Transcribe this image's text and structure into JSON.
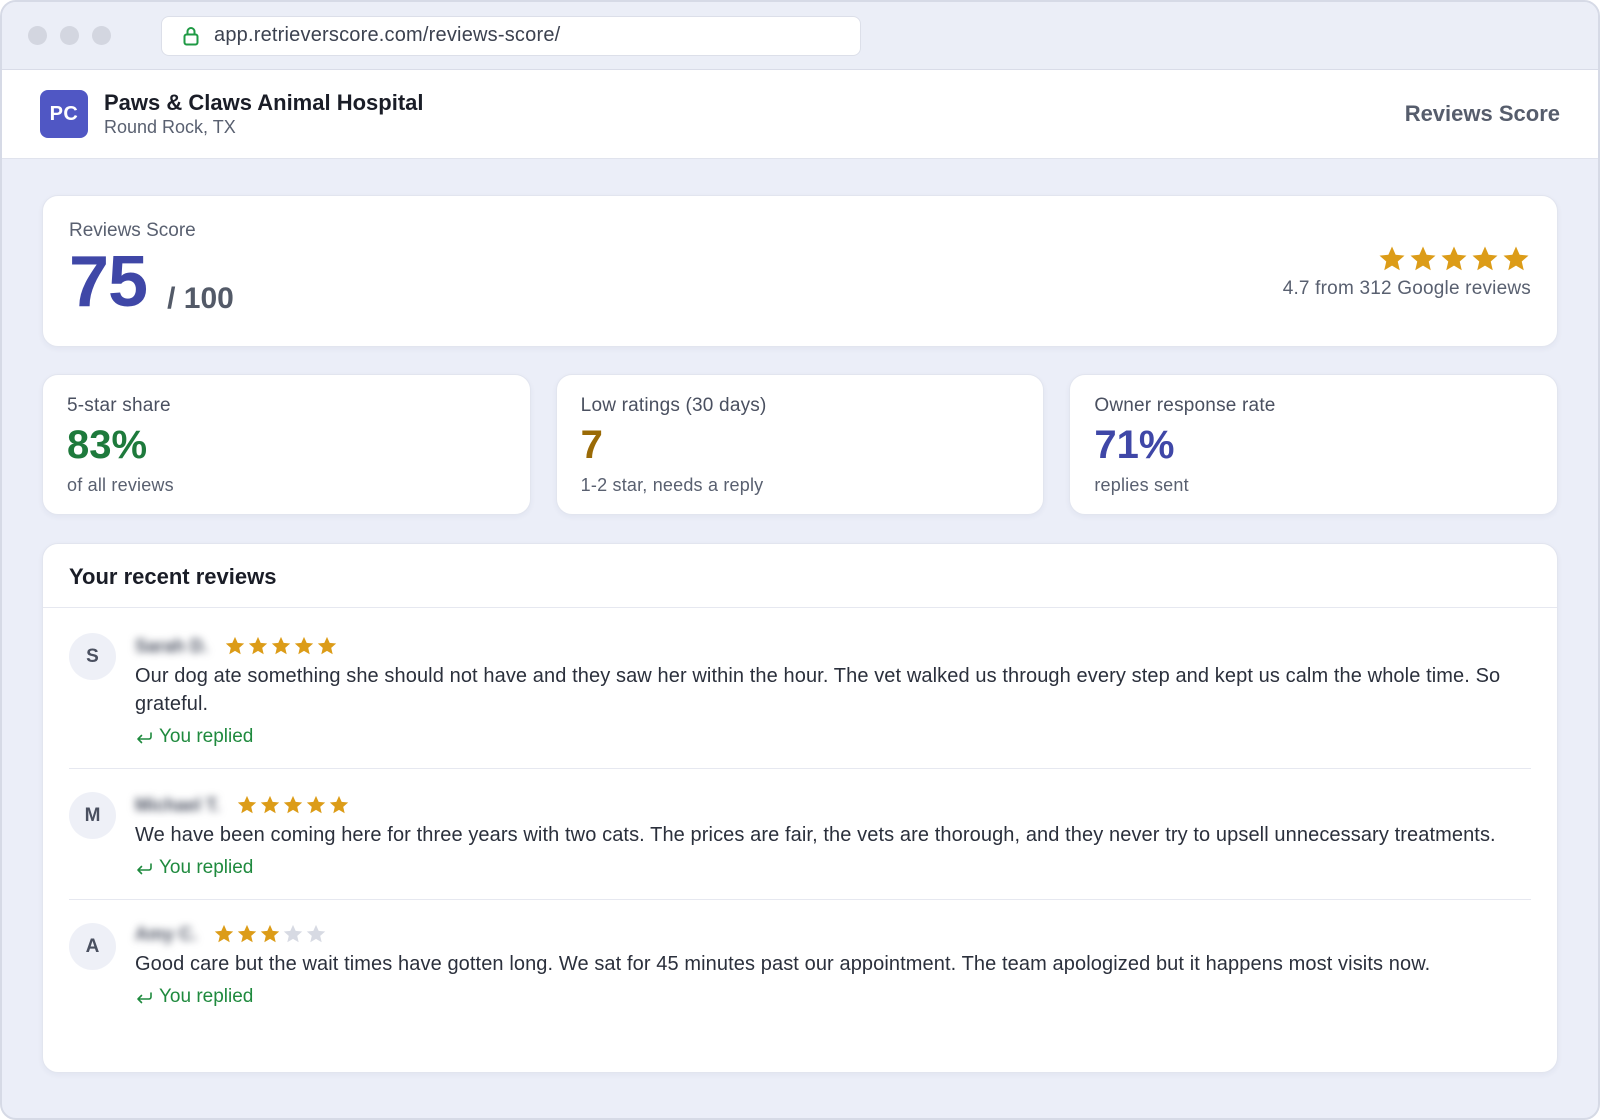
{
  "browser": {
    "url": "app.retrieverscore.com/reviews-score/"
  },
  "header": {
    "logo_initials": "PC",
    "business_name": "Paws & Claws Animal Hospital",
    "location": "Round Rock, TX",
    "title": "Reviews Score"
  },
  "score": {
    "label": "Reviews Score",
    "value": "75",
    "out_of": "/ 100",
    "rating_stars": 5,
    "rating_text": "4.7 from 312 Google reviews"
  },
  "metrics": [
    {
      "label": "5-star share",
      "value": "83%",
      "sub": "of all reviews",
      "color": "#1e7a3c"
    },
    {
      "label": "Low ratings (30 days)",
      "value": "7",
      "sub": "1-2 star, needs a reply",
      "color": "#9a6a06"
    },
    {
      "label": "Owner response rate",
      "value": "71%",
      "sub": "replies sent",
      "color": "#3f47a7"
    }
  ],
  "reviews": {
    "title": "Your recent reviews",
    "items": [
      {
        "initial": "S",
        "name": "Sarah D.",
        "stars": 5,
        "text": "Our dog ate something she should not have and they saw her within the hour. The vet walked us through every step and kept us calm the whole time. So grateful.",
        "status": "You replied"
      },
      {
        "initial": "M",
        "name": "Michael T.",
        "stars": 5,
        "text": "We have been coming here for three years with two cats. The prices are fair, the vets are thorough, and they never try to upsell unnecessary treatments.",
        "status": "You replied"
      },
      {
        "initial": "A",
        "name": "Amy C.",
        "stars": 3,
        "text": "Good care but the wait times have gotten long. We sat for 45 minutes past our appointment. The team apologized but it happens most visits now.",
        "status": "You replied"
      }
    ]
  },
  "colors": {
    "star_filled": "#dc9c18",
    "star_empty": "#d7dae3",
    "accent": "#3f47a7",
    "replied": "#1f8a3e"
  }
}
